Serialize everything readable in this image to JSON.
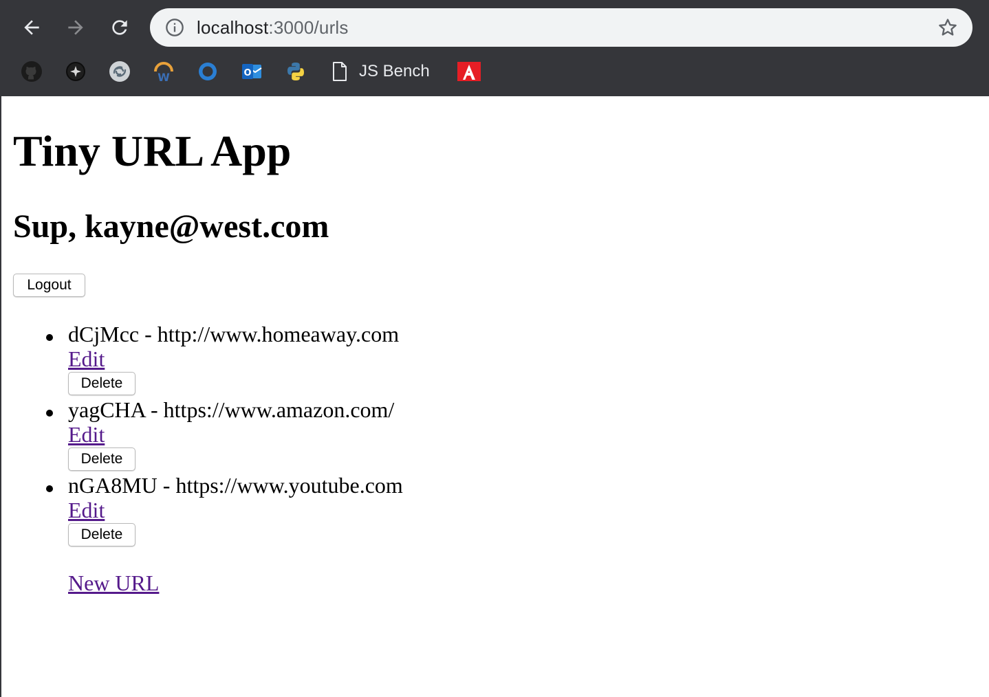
{
  "browser": {
    "url_host": "localhost",
    "url_path": ":3000/urls",
    "bookmarks": [
      {
        "icon": "github-icon"
      },
      {
        "icon": "compass-icon"
      },
      {
        "icon": "swirl-icon"
      },
      {
        "icon": "w-icon"
      },
      {
        "icon": "ring-icon"
      },
      {
        "icon": "outlook-icon"
      },
      {
        "icon": "python-icon"
      },
      {
        "icon": "document-icon",
        "label": "JS Bench"
      },
      {
        "icon": "adobe-icon"
      }
    ]
  },
  "page": {
    "title": "Tiny URL App",
    "greeting": "Sup, kayne@west.com",
    "logout_label": "Logout",
    "urls": [
      {
        "short": "dCjMcc",
        "long": "http://www.homeaway.com",
        "line": "dCjMcc - http://www.homeaway.com",
        "edit_label": "Edit",
        "delete_label": "Delete"
      },
      {
        "short": "yagCHA",
        "long": "https://www.amazon.com/",
        "line": "yagCHA - https://www.amazon.com/",
        "edit_label": "Edit",
        "delete_label": "Delete"
      },
      {
        "short": "nGA8MU",
        "long": "https://www.youtube.com",
        "line": "nGA8MU - https://www.youtube.com",
        "edit_label": "Edit",
        "delete_label": "Delete"
      }
    ],
    "new_url_label": "New URL"
  },
  "colors": {
    "chrome_bg": "#35363a",
    "omnibox_bg": "#f1f3f4",
    "visited_link": "#551a8b"
  }
}
